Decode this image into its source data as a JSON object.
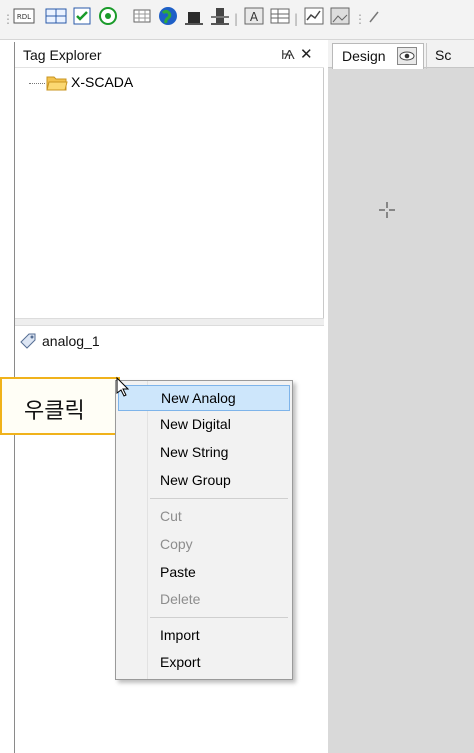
{
  "toolbar": {
    "icons": [
      "rdl-icon",
      "grid-check-icon",
      "checkbox-icon",
      "target-icon",
      "grid-icon",
      "globe-icon",
      "block-icon",
      "bar-block-icon",
      "text-field-icon",
      "table-icon",
      "chart-icon",
      "image-icon",
      "pen-icon"
    ]
  },
  "tag_explorer": {
    "title": "Tag Explorer",
    "pin_glyph": "Ѩ",
    "close_glyph": "✕",
    "tree_root": "X-SCADA",
    "tags": [
      "analog_1"
    ]
  },
  "tabs": {
    "design": "Design",
    "script": "Sc"
  },
  "callout": {
    "text": "우클릭"
  },
  "context_menu": {
    "items": [
      {
        "label": "New Analog",
        "enabled": true,
        "highlighted": true
      },
      {
        "label": "New Digital",
        "enabled": true
      },
      {
        "label": "New String",
        "enabled": true
      },
      {
        "label": "New Group",
        "enabled": true
      },
      {
        "label": "Cut",
        "enabled": false
      },
      {
        "label": "Copy",
        "enabled": false
      },
      {
        "label": "Paste",
        "enabled": true
      },
      {
        "label": "Delete",
        "enabled": false
      },
      {
        "label": "Import",
        "enabled": true
      },
      {
        "label": "Export",
        "enabled": true
      }
    ]
  },
  "colors": {
    "callout_border": "#f0b21b",
    "menu_highlight": "#cde6fb",
    "canvas_bg": "#d9d9d9"
  }
}
